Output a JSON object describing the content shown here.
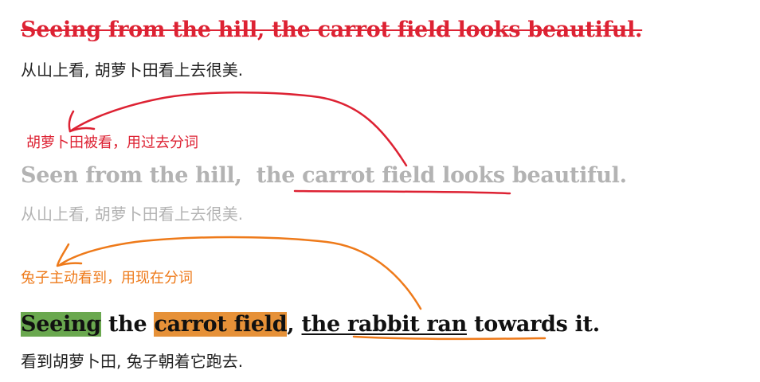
{
  "sentence_wrong": {
    "english": "Seeing from the hill, the carrot field looks beautiful.",
    "chinese": "从山上看, 胡萝卜田看上去很美."
  },
  "sentence_correct": {
    "english_before": "Seen from the hill,",
    "english_subject": "the carrot field",
    "english_after": "looks beautiful.",
    "chinese": "从山上看, 胡萝卜田看上去很美.",
    "note": "胡萝卜田被看，用过去分词"
  },
  "sentence_active": {
    "english_participle": "Seeing",
    "english_the": "the",
    "english_object": "carrot field",
    "english_comma": ",",
    "english_subject": "the rabbit ran",
    "english_rest": "towards it.",
    "chinese": "看到胡萝卜田, 兔子朝着它跑去.",
    "note": "兔子主动看到，用现在分词"
  },
  "colors": {
    "red": "#dd2233",
    "orange": "#ee7a1a",
    "gray": "#b3b3b3",
    "highlight_green": "#6aa84f",
    "highlight_orange": "#e69138"
  }
}
